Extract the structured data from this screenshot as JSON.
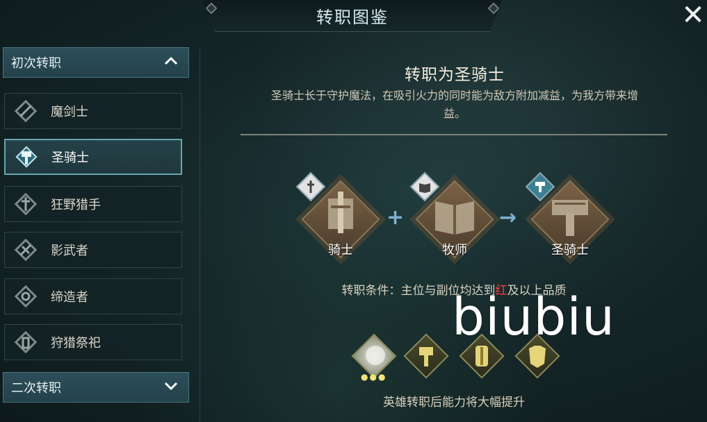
{
  "header": {
    "title": "转职图鉴",
    "close_label": "✕"
  },
  "sidebar": {
    "first_section": {
      "label": "初次转职",
      "expanded": true
    },
    "items": [
      {
        "label": "魔剑士",
        "icon": "magic-sword-icon",
        "selected": false
      },
      {
        "label": "圣骑士",
        "icon": "paladin-hammer-icon",
        "selected": true
      },
      {
        "label": "狂野猎手",
        "icon": "wild-hunter-icon",
        "selected": false
      },
      {
        "label": "影武者",
        "icon": "shadow-warrior-icon",
        "selected": false
      },
      {
        "label": "缔造者",
        "icon": "creator-icon",
        "selected": false
      },
      {
        "label": "狩猎祭祀",
        "icon": "hunt-priest-icon",
        "selected": false
      }
    ],
    "second_section": {
      "label": "二次转职",
      "expanded": false
    }
  },
  "main": {
    "title": "转职为圣骑士",
    "description": "圣骑士长于守护魔法，在吸引火力的同时能为敌方附加减益，为我方带来增益。",
    "formula": {
      "a": {
        "label": "骑士",
        "icon": "knight-icon"
      },
      "plus": "+",
      "b": {
        "label": "牧师",
        "icon": "priest-icon"
      },
      "arrow": "→",
      "result": {
        "label": "圣骑士",
        "icon": "paladin-icon"
      }
    },
    "condition": {
      "prefix": "转职条件：主位与副位均达到",
      "highlight": "红",
      "suffix": "及以上品质"
    },
    "rewards": [
      "hero-orb-icon",
      "hammer-skill-icon",
      "shield-skill-icon",
      "armor-skill-icon"
    ],
    "reward_caption": "英雄转职后能力将大幅提升"
  },
  "watermark": "biubiu",
  "colors": {
    "accent": "#6aa6b2",
    "highlight_red": "#ff3b3b",
    "diamond": "#7a6246"
  }
}
